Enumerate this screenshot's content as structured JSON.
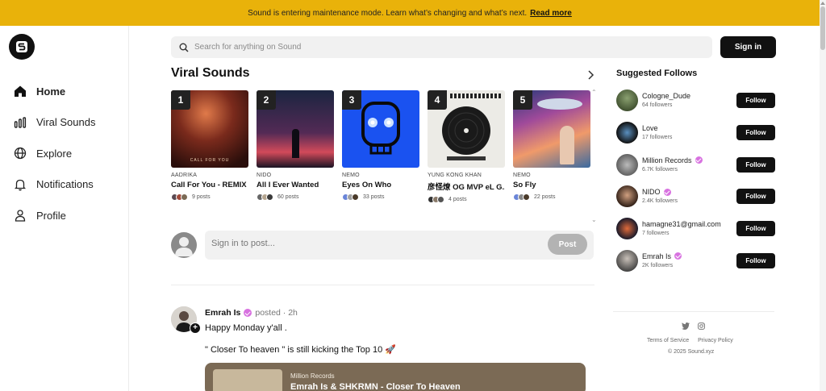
{
  "banner": {
    "text": "Sound is entering maintenance mode. Learn what’s changing and what’s next.",
    "link": "Read more"
  },
  "nav": [
    {
      "label": "Home",
      "icon": "home-icon",
      "active": true
    },
    {
      "label": "Viral Sounds",
      "icon": "bars-icon",
      "active": false
    },
    {
      "label": "Explore",
      "icon": "globe-icon",
      "active": false
    },
    {
      "label": "Notifications",
      "icon": "bell-icon",
      "active": false
    },
    {
      "label": "Profile",
      "icon": "user-icon",
      "active": false
    }
  ],
  "search": {
    "placeholder": "Search for anything on Sound"
  },
  "header": {
    "signin_label": "Sign in"
  },
  "viral": {
    "title": "Viral Sounds",
    "cards": [
      {
        "rank": "1",
        "artist": "AADRIKA",
        "track": "Call For You - REMIX",
        "posts": "9 posts",
        "art_caption": "CALL FOR YOU"
      },
      {
        "rank": "2",
        "artist": "NIDO",
        "track": "All I Ever Wanted",
        "posts": "60 posts"
      },
      {
        "rank": "3",
        "artist": "NEMO",
        "track": "Eyes On Who",
        "posts": "33 posts"
      },
      {
        "rank": "4",
        "artist": "YUNG KONG KHAN",
        "track": "彦怪燎 OG MVP eL G...",
        "posts": "4 posts"
      },
      {
        "rank": "5",
        "artist": "NEMO",
        "track": "So Fly",
        "posts": "22 posts"
      }
    ]
  },
  "composer": {
    "placeholder": "Sign in to post...",
    "post_label": "Post"
  },
  "post": {
    "author": "Emrah Is",
    "meta": "posted · 2h",
    "line1": "Happy Monday y'all .",
    "line2": "\" Closer To heaven \" is still kicking the Top 10 🚀",
    "embed_label": "Million Records",
    "embed_title": "Emrah Is & SHKRMN - Closer To Heaven"
  },
  "suggested": {
    "title": "Suggested Follows",
    "follow_label": "Follow",
    "items": [
      {
        "name": "Cologne_Dude",
        "followers": "64 followers",
        "verified": false
      },
      {
        "name": "Love",
        "followers": "17 followers",
        "verified": false
      },
      {
        "name": "Million Records",
        "followers": "6.7K followers",
        "verified": true
      },
      {
        "name": "NIDO",
        "followers": "2.4K followers",
        "verified": true
      },
      {
        "name": "hamagne31@gmail.com",
        "followers": "7 followers",
        "verified": false
      },
      {
        "name": "Emrah Is",
        "followers": "2K followers",
        "verified": true
      }
    ]
  },
  "footer": {
    "terms": "Terms of Service",
    "privacy": "Privacy Policy",
    "copyright": "© 2025 Sound.xyz"
  },
  "colors": {
    "banner": "#e9b20a",
    "accent_verified": "#d872e0",
    "button_dark": "#111111"
  }
}
